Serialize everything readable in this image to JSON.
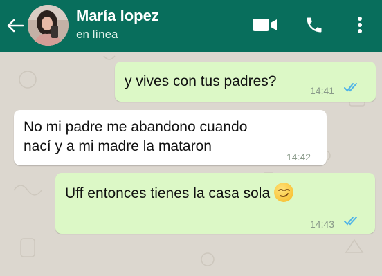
{
  "contact": {
    "name": "María lopez",
    "status": "en línea"
  },
  "messages": [
    {
      "direction": "outgoing",
      "text": "y vives con tus padres?",
      "time": "14:41",
      "read": true
    },
    {
      "direction": "incoming",
      "lines": [
        "No mi padre me abandono cuando",
        "nací y a mi madre la mataron"
      ],
      "time": "14:42"
    },
    {
      "direction": "outgoing",
      "text": "Uff entonces tienes la casa sola",
      "emoji": "smirking-face",
      "time": "14:43",
      "read": true
    }
  ],
  "colors": {
    "header": "#086e5c",
    "outgoing_bubble": "#dcf8c6",
    "incoming_bubble": "#ffffff",
    "read_ticks": "#4fb3e8",
    "wallpaper": "#dcd7cf"
  },
  "icons": [
    "back-arrow-icon",
    "video-call-icon",
    "phone-icon",
    "more-options-icon",
    "double-check-icon",
    "smirk-emoji-icon"
  ]
}
